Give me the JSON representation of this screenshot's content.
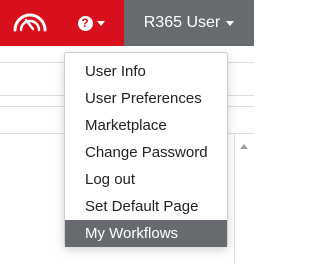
{
  "colors": {
    "topbar": "#d8101d",
    "user_button": "#676b70",
    "active_item": "#676b70"
  },
  "topbar": {
    "logo_icon": "speedometer-logo",
    "help_icon": "question-circle-icon",
    "user_label": "R365 User"
  },
  "user_menu": {
    "items": [
      {
        "label": "User Info"
      },
      {
        "label": "User Preferences"
      },
      {
        "label": "Marketplace"
      },
      {
        "label": "Change Password"
      },
      {
        "label": "Log out"
      },
      {
        "label": "Set Default Page"
      },
      {
        "label": "My Workflows",
        "highlighted": true
      }
    ]
  }
}
